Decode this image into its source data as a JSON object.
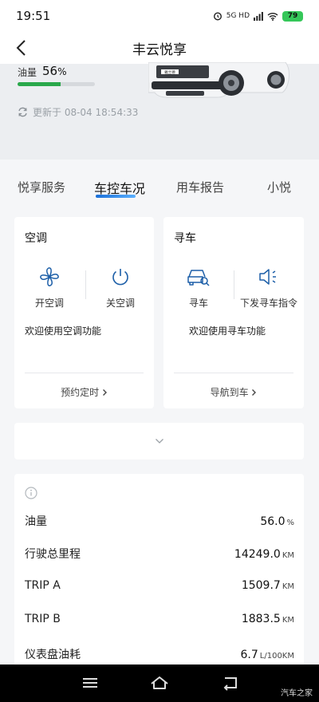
{
  "status_bar": {
    "time": "19:51",
    "network": "5G HD",
    "battery": "79"
  },
  "header": {
    "title": "丰云悦享"
  },
  "hero": {
    "fuel_label": "油量",
    "fuel_value": "56",
    "fuel_unit": "%",
    "fuel_fraction": 0.56,
    "updated_text": "更新于 08-04 18:54:33",
    "plate_text": "雅兰德"
  },
  "tabs": [
    {
      "label": "悦享服务",
      "active": false
    },
    {
      "label": "车控车况",
      "active": true
    },
    {
      "label": "用车报告",
      "active": false
    },
    {
      "label": "小悦",
      "active": false
    }
  ],
  "ac_card": {
    "title": "空调",
    "on_label": "开空调",
    "off_label": "关空调",
    "welcome": "欢迎使用空调功能",
    "link": "预约定时"
  },
  "find_card": {
    "title": "寻车",
    "find_label": "寻车",
    "command_label": "下发寻车指令",
    "welcome": "欢迎使用寻车功能",
    "link": "导航到车"
  },
  "stats": [
    {
      "name": "油量",
      "value": "56.0",
      "unit": "%"
    },
    {
      "name": "行驶总里程",
      "value": "14249.0",
      "unit": "KM"
    },
    {
      "name": "TRIP A",
      "value": "1509.7",
      "unit": "KM"
    },
    {
      "name": "TRIP B",
      "value": "1883.5",
      "unit": "KM"
    },
    {
      "name": "仪表盘油耗",
      "value": "6.7",
      "unit": "L/100KM"
    }
  ],
  "watermark": "汽车之家",
  "colors": {
    "accent": "#1a6fd8",
    "fuel_bar": "#2aa84b",
    "icon_blue": "#1d5fa8"
  }
}
